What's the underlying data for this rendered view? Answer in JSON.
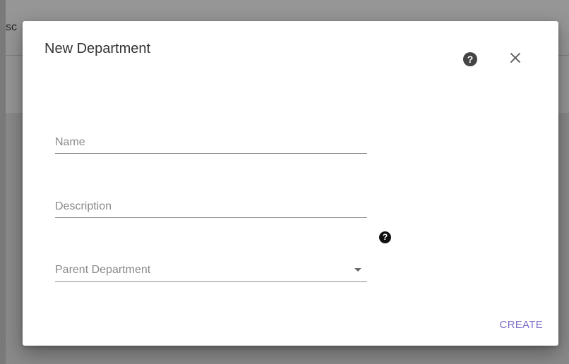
{
  "background": {
    "partial_text": "sc"
  },
  "dialog": {
    "title": "New Department",
    "help_icon": "question-circle-icon",
    "help_glyph": "?",
    "close_icon": "close-icon",
    "fields": {
      "name": {
        "placeholder": "Name",
        "value": ""
      },
      "description": {
        "placeholder": "Description",
        "value": ""
      },
      "parent_department": {
        "placeholder": "Parent Department",
        "selected": ""
      }
    },
    "field_help_glyph": "?",
    "create_label": "CREATE"
  },
  "colors": {
    "accent": "#7b6fc9",
    "overlay": "#8a8a8a",
    "dialog_bg": "#ffffff"
  }
}
